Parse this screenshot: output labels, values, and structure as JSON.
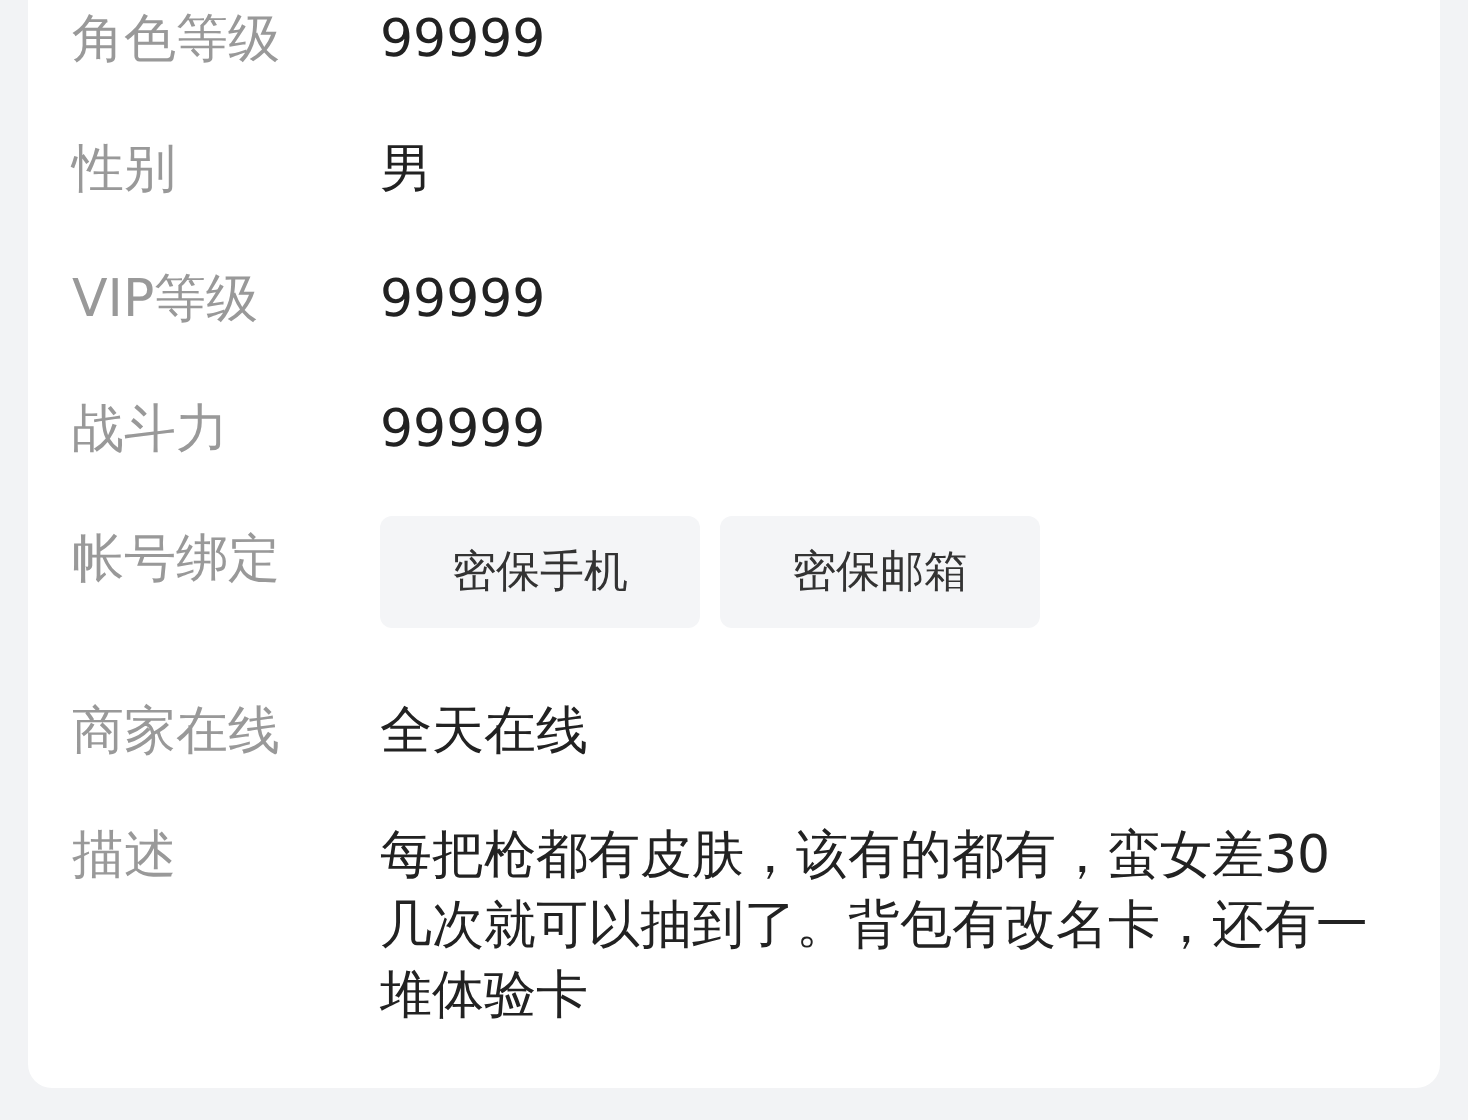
{
  "fields": [
    {
      "kind": "text",
      "label": "角色等级",
      "value": "99999"
    },
    {
      "kind": "text",
      "label": "性别",
      "value": "男"
    },
    {
      "kind": "text",
      "label": "VIP等级",
      "value": "99999"
    },
    {
      "kind": "text",
      "label": "战斗力",
      "value": "99999"
    },
    {
      "kind": "buttons",
      "label": "帐号绑定",
      "buttons": [
        "密保手机",
        "密保邮箱"
      ]
    },
    {
      "kind": "text",
      "label": "商家在线",
      "value": "全天在线"
    },
    {
      "kind": "paragraph",
      "label": "描述",
      "value": "每把枪都有皮肤，该有的都有，蛮女差30几次就可以抽到了。背包有改名卡，还有一堆体验卡"
    }
  ]
}
